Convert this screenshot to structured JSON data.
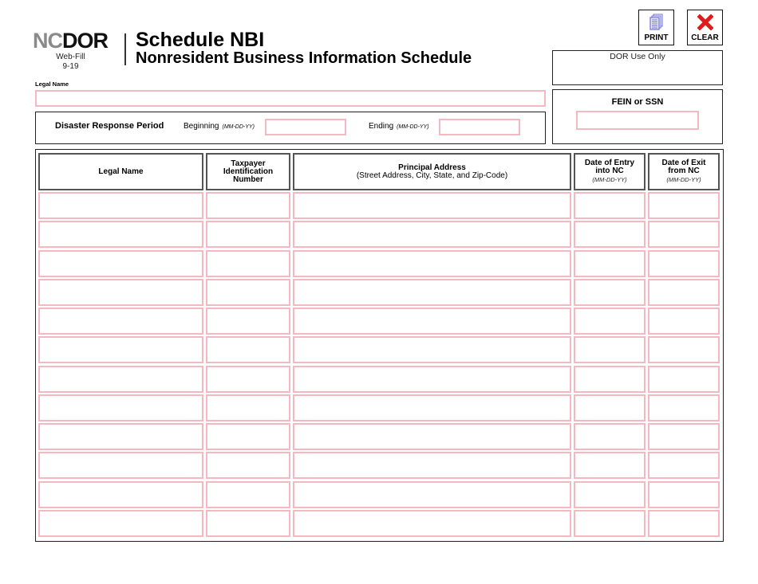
{
  "header": {
    "logo": {
      "nc": "NC",
      "dor": "DOR",
      "edition": "Web-Fill",
      "version": "9-19"
    },
    "title": "Schedule NBI",
    "subtitle": "Nonresident Business Information Schedule"
  },
  "toolbar": {
    "print_label": "PRINT",
    "clear_label": "CLEAR",
    "print_icon": "document-stack-icon",
    "clear_icon": "red-x-icon",
    "print_icon_color": "#6b6fd6",
    "clear_icon_color": "#e01b1b"
  },
  "dor_use_only": {
    "label": "DOR Use Only"
  },
  "legal_name": {
    "label": "Legal Name",
    "value": ""
  },
  "disaster_period": {
    "title": "Disaster Response Period",
    "beginning_label": "Beginning",
    "ending_label": "Ending",
    "date_format": "(MM-DD-YY)",
    "beginning_value": "",
    "ending_value": ""
  },
  "fein": {
    "label": "FEIN or SSN",
    "value": ""
  },
  "table": {
    "columns": [
      {
        "title": "Legal Name",
        "subtitle": "",
        "format": ""
      },
      {
        "title": "Taxpayer Identification Number",
        "subtitle": "",
        "format": ""
      },
      {
        "title": "Principal Address",
        "subtitle": "(Street Address, City, State, and Zip-Code)",
        "format": ""
      },
      {
        "title": "Date of Entry into NC",
        "subtitle": "",
        "format": "(MM-DD-YY)"
      },
      {
        "title": "Date of Exit from NC",
        "subtitle": "",
        "format": "(MM-DD-YY)"
      }
    ],
    "rows": [
      [
        "",
        "",
        "",
        "",
        ""
      ],
      [
        "",
        "",
        "",
        "",
        ""
      ],
      [
        "",
        "",
        "",
        "",
        ""
      ],
      [
        "",
        "",
        "",
        "",
        ""
      ],
      [
        "",
        "",
        "",
        "",
        ""
      ],
      [
        "",
        "",
        "",
        "",
        ""
      ],
      [
        "",
        "",
        "",
        "",
        ""
      ],
      [
        "",
        "",
        "",
        "",
        ""
      ],
      [
        "",
        "",
        "",
        "",
        ""
      ],
      [
        "",
        "",
        "",
        "",
        ""
      ],
      [
        "",
        "",
        "",
        "",
        ""
      ],
      [
        "",
        "",
        "",
        "",
        ""
      ]
    ]
  },
  "colors": {
    "field_border": "#f4b8c1",
    "frame_border": "#222222"
  }
}
